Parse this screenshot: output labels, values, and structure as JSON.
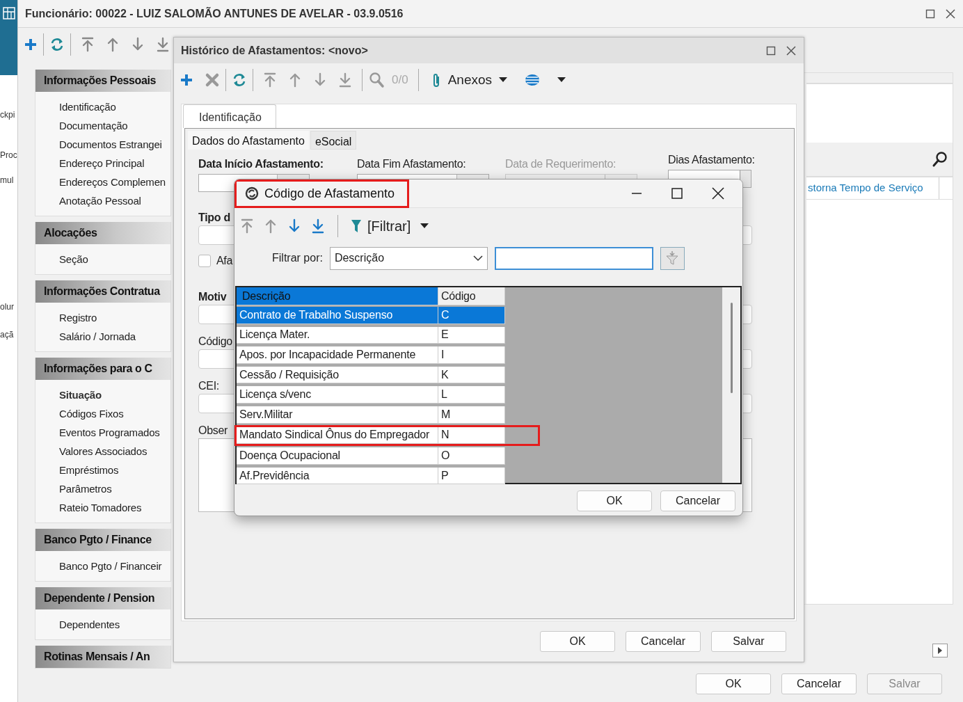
{
  "app_strip": {
    "fragments": [
      "ckpi",
      "Proc",
      "mul",
      "olur",
      "açã"
    ]
  },
  "main_window": {
    "title": "Funcionário: 00022 - LUIZ SALOMÃO ANTUNES DE AVELAR - 03.9.0516",
    "sidebar": [
      {
        "title": "Informações Pessoais",
        "items": [
          {
            "label": "Identificação",
            "selected": false
          },
          {
            "label": "Documentação",
            "selected": false
          },
          {
            "label": "Documentos Estrangei",
            "selected": false
          },
          {
            "label": "Endereço Principal",
            "selected": false
          },
          {
            "label": "Endereços Complemen",
            "selected": false
          },
          {
            "label": "Anotação Pessoal",
            "selected": false
          }
        ]
      },
      {
        "title": "Alocações",
        "items": [
          {
            "label": "Seção",
            "selected": false
          }
        ]
      },
      {
        "title": "Informações Contratua",
        "items": [
          {
            "label": "Registro",
            "selected": false
          },
          {
            "label": "Salário / Jornada",
            "selected": false
          }
        ]
      },
      {
        "title": "Informações para o C",
        "items": [
          {
            "label": "Situação",
            "selected": true
          },
          {
            "label": "Códigos Fixos",
            "selected": false
          },
          {
            "label": "Eventos Programados",
            "selected": false
          },
          {
            "label": "Valores Associados",
            "selected": false
          },
          {
            "label": "Empréstimos",
            "selected": false
          },
          {
            "label": "Parâmetros",
            "selected": false
          },
          {
            "label": "Rateio Tomadores",
            "selected": false
          }
        ]
      },
      {
        "title": "Banco Pgto / Finance",
        "items": [
          {
            "label": "Banco Pgto / Financeir",
            "selected": false
          }
        ]
      },
      {
        "title": "Dependente / Pension",
        "items": [
          {
            "label": "Dependentes",
            "selected": false
          }
        ]
      },
      {
        "title": "Rotinas Mensais / An"
      }
    ],
    "right_panel": {
      "cell": "storna Tempo de Serviço"
    },
    "buttons": [
      {
        "label": "OK",
        "disabled": false
      },
      {
        "label": "Cancelar",
        "disabled": false
      },
      {
        "label": "Salvar",
        "disabled": true
      }
    ]
  },
  "history_window": {
    "title": "Histórico de Afastamentos: <novo>",
    "record_counter": "0/0",
    "attachments": "Anexos",
    "tabs": [
      {
        "label": "Identificação",
        "selected": true
      }
    ],
    "subtabs": [
      {
        "label": "Dados do Afastamento",
        "selected": true
      },
      {
        "label": "eSocial",
        "selected": false
      }
    ],
    "top_fields": [
      {
        "label": "Data Início Afastamento:",
        "kind": "date",
        "required": true,
        "disabled": false
      },
      {
        "label": "Data Fim Afastamento:",
        "kind": "date",
        "required": false,
        "disabled": false
      },
      {
        "label": "Data de Requerimento:",
        "kind": "date",
        "required": false,
        "disabled": true
      },
      {
        "label": "Dias Afastamento:",
        "kind": "spin",
        "required": false,
        "disabled": false
      }
    ],
    "fields": [
      {
        "label": "Tipo d",
        "kind": "text",
        "required": true
      },
      {
        "label": "Afa",
        "kind": "checkbox",
        "required": false,
        "checked": false
      },
      {
        "label": "Motiv",
        "kind": "text",
        "required": true
      },
      {
        "label": "Código",
        "kind": "text",
        "required": false
      },
      {
        "label": "CEI:",
        "kind": "text",
        "required": false
      },
      {
        "label": "Obser",
        "kind": "textarea",
        "required": false
      }
    ],
    "buttons": [
      {
        "label": "OK",
        "disabled": false
      },
      {
        "label": "Cancelar",
        "disabled": false
      },
      {
        "label": "Salvar",
        "disabled": false
      }
    ]
  },
  "dialog": {
    "title": "Código de Afastamento",
    "highlighted": true,
    "filter_menu": "[Filtrar]",
    "filter_label": "Filtrar por:",
    "filter_select": "Descrição",
    "columns": [
      {
        "label": "Descrição",
        "selected": true
      },
      {
        "label": "Código",
        "selected": false
      }
    ],
    "rows": [
      {
        "description": "Contrato de Trabalho Suspenso",
        "code": "C",
        "selected": true,
        "highlighted": false
      },
      {
        "description": "Licença Mater.",
        "code": "E",
        "selected": false,
        "highlighted": false
      },
      {
        "description": "Apos. por Incapacidade Permanente",
        "code": "I",
        "selected": false,
        "highlighted": false
      },
      {
        "description": "Cessão / Requisição",
        "code": "K",
        "selected": false,
        "highlighted": false
      },
      {
        "description": "Licença s/venc",
        "code": "L",
        "selected": false,
        "highlighted": false
      },
      {
        "description": "Serv.Militar",
        "code": "M",
        "selected": false,
        "highlighted": false
      },
      {
        "description": "Mandato Sindical Ônus do Empregador",
        "code": "N",
        "selected": false,
        "highlighted": true
      },
      {
        "description": "Doença Ocupacional",
        "code": "O",
        "selected": false,
        "highlighted": false
      },
      {
        "description": "Af.Previdência",
        "code": "P",
        "selected": false,
        "highlighted": false
      }
    ],
    "buttons": [
      {
        "label": "OK",
        "disabled": false
      },
      {
        "label": "Cancelar",
        "disabled": false
      }
    ]
  }
}
